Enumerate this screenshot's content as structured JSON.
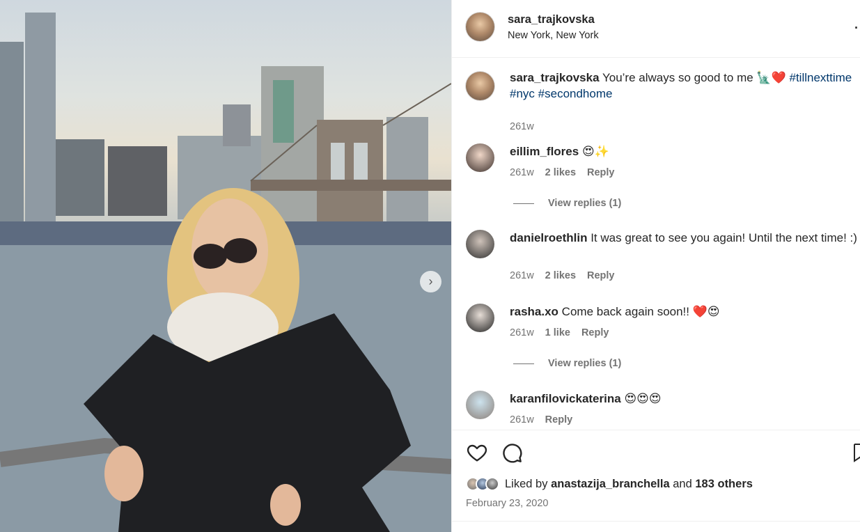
{
  "post": {
    "username": "sara_trajkovska",
    "location": "New York, New York"
  },
  "caption": {
    "username": "sara_trajkovska",
    "text": "You’re always so good to me 🗽❤️",
    "hashtags": [
      "#tillnexttime",
      "#nyc",
      "#secondhome"
    ],
    "time": "261w"
  },
  "comments": [
    {
      "username": "eillim_flores",
      "text": "😍✨",
      "time": "261w",
      "likes": "2 likes",
      "reply": "Reply",
      "view_replies": "View replies (1)"
    },
    {
      "username": "danielroethlin",
      "text": "It was great to see you again! Until the next time! :)",
      "time": "261w",
      "likes": "2 likes",
      "reply": "Reply"
    },
    {
      "username": "rasha.xo",
      "text": "Come back again soon!! ❤️😍",
      "time": "261w",
      "likes": "1 like",
      "reply": "Reply",
      "view_replies": "View replies (1)"
    },
    {
      "username": "karanfilovickaterina",
      "text": "😍😍😍",
      "time": "261w",
      "reply": "Reply"
    }
  ],
  "likes": {
    "prefix": "Liked by",
    "user": "anastazija_branchella",
    "joiner": "and",
    "others": "183 others"
  },
  "date": "February 23, 2020",
  "icons": [
    "heart-icon",
    "comment-icon",
    "bookmark-icon",
    "more-options-icon",
    "chevron-right-icon"
  ]
}
